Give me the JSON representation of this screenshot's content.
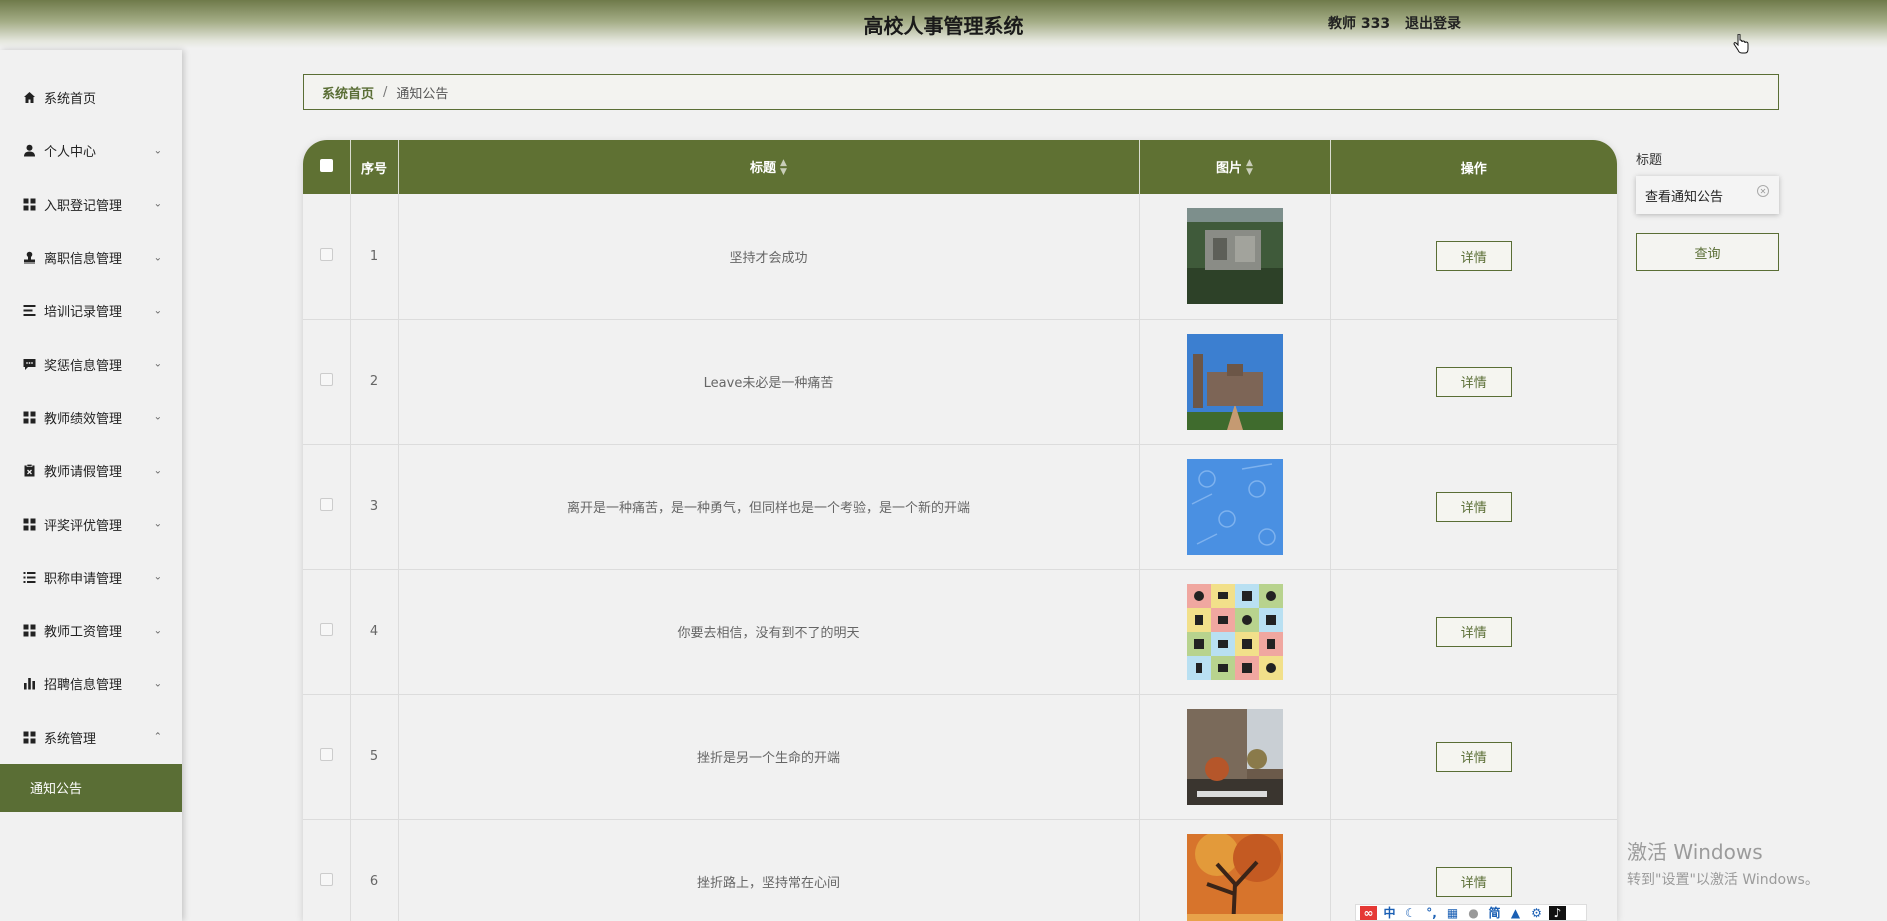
{
  "header": {
    "title": "高校人事管理系统",
    "user_label": "教师 333",
    "logout_label": "退出登录"
  },
  "sidebar": {
    "items": [
      {
        "label": "系统首页",
        "icon": "home-icon",
        "expandable": false
      },
      {
        "label": "个人中心",
        "icon": "user-icon",
        "expandable": true
      },
      {
        "label": "入职登记管理",
        "icon": "grid-icon",
        "expandable": true
      },
      {
        "label": "离职信息管理",
        "icon": "stamp-icon",
        "expandable": true
      },
      {
        "label": "培训记录管理",
        "icon": "list-icon",
        "expandable": true
      },
      {
        "label": "奖惩信息管理",
        "icon": "comment-icon",
        "expandable": true
      },
      {
        "label": "教师绩效管理",
        "icon": "grid-icon",
        "expandable": true
      },
      {
        "label": "教师请假管理",
        "icon": "clipboard-icon",
        "expandable": true
      },
      {
        "label": "评奖评优管理",
        "icon": "grid-icon",
        "expandable": true
      },
      {
        "label": "职称申请管理",
        "icon": "list-icon",
        "expandable": true
      },
      {
        "label": "教师工资管理",
        "icon": "grid-icon",
        "expandable": true
      },
      {
        "label": "招聘信息管理",
        "icon": "bar-chart-icon",
        "expandable": true
      },
      {
        "label": "系统管理",
        "icon": "grid-icon",
        "expandable": true,
        "expanded": true
      }
    ],
    "submenu": [
      {
        "label": "通知公告",
        "active": true
      }
    ]
  },
  "breadcrumb": {
    "home": "系统首页",
    "separator": "/",
    "current": "通知公告"
  },
  "table": {
    "columns": {
      "index": "序号",
      "title": "标题",
      "image": "图片",
      "action": "操作"
    },
    "rows": [
      {
        "index": "1",
        "title": "坚持才会成功",
        "image": "aerial-campus-photo",
        "action": "详情"
      },
      {
        "index": "2",
        "title": "Leave未必是一种痛苦",
        "image": "university-building-photo",
        "action": "详情"
      },
      {
        "index": "3",
        "title": "离开是一种痛苦，是一种勇气，但同样也是一个考验，是一个新的开端",
        "image": "blue-pattern-image",
        "action": "详情"
      },
      {
        "index": "4",
        "title": "你要去相信，没有到不了的明天",
        "image": "icon-grid-image",
        "action": "详情"
      },
      {
        "index": "5",
        "title": "挫折是另一个生命的开端",
        "image": "courtyard-photo",
        "action": "详情"
      },
      {
        "index": "6",
        "title": "挫折路上，坚持常在心间",
        "image": "autumn-tree-photo",
        "action": "详情"
      }
    ]
  },
  "search": {
    "label": "标题",
    "value": "查看通知公告",
    "button": "查询"
  },
  "watermark": {
    "line1": "激活 Windows",
    "line2": "转到\"设置\"以激活 Windows。"
  },
  "ime": {
    "mode": "中",
    "charset": "简"
  },
  "colors": {
    "accent": "#5f7133",
    "header_gradient_top": "#6f7a4a",
    "background": "#f1f1f1"
  }
}
